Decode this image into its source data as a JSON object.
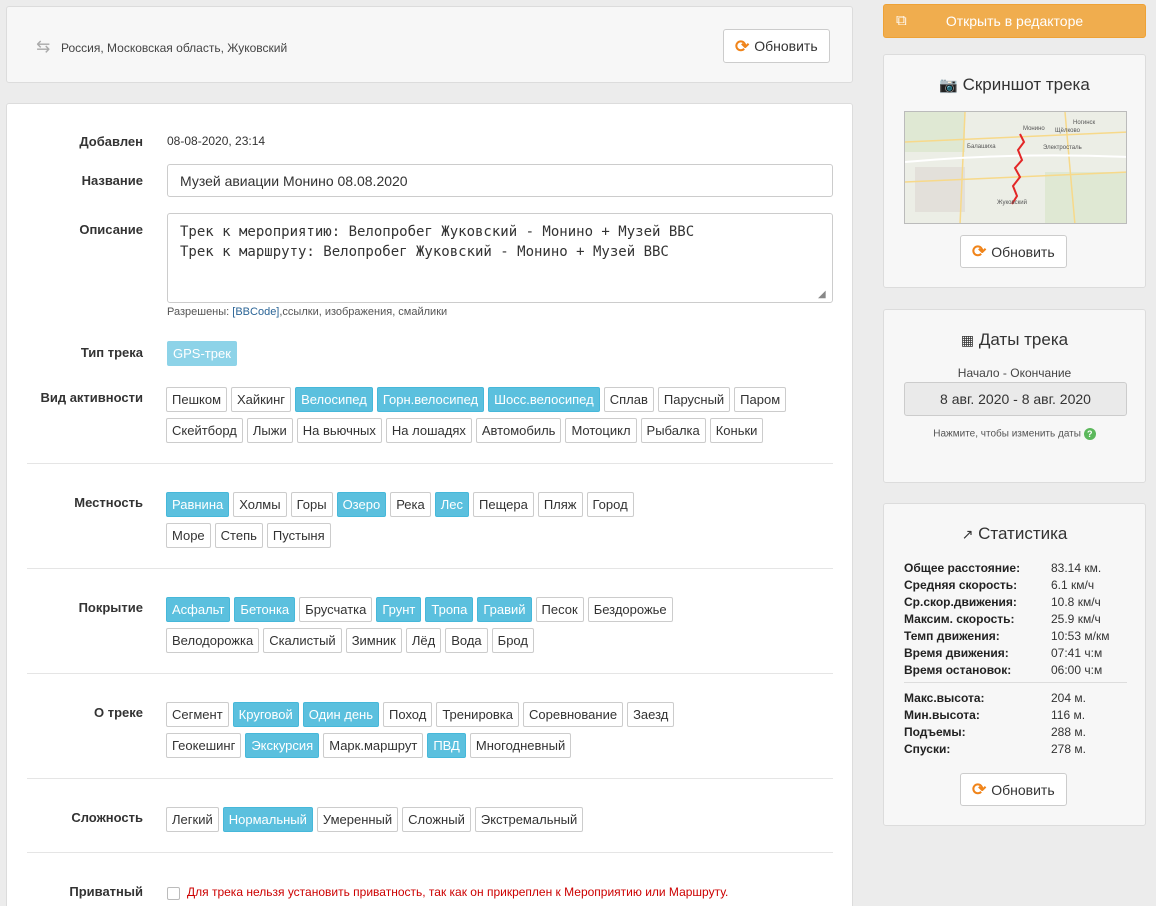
{
  "location": {
    "text": "Россия, Московская область, Жуковский",
    "refresh_label": "Обновить"
  },
  "form": {
    "added_label": "Добавлен",
    "added_value": "08-08-2020, 23:14",
    "name_label": "Название",
    "name_value": "Музей авиации Монино 08.08.2020",
    "desc_label": "Описание",
    "desc_value": "Трек к мероприятию: Велопробег Жуковский - Монино + Музей ВВС\nТрек к маршруту: Велопробег Жуковский - Монино + Музей ВВС",
    "allowed_prefix": "Разрешены: ",
    "allowed_link": "[BBCode]",
    "allowed_suffix": ",ссылки, изображения, смайлики",
    "type_label": "Тип трека",
    "type_value": "GPS-трек",
    "activity_label": "Вид активности",
    "terrain_label": "Местность",
    "surface_label": "Покрытие",
    "about_label": "О треке",
    "difficulty_label": "Сложность",
    "private_label": "Приватный",
    "private_note": "Для трека нельзя установить приватность, так как он прикреплен к Мероприятию или Маршруту."
  },
  "activity": [
    [
      {
        "t": "Пешком",
        "on": false
      },
      {
        "t": "Хайкинг",
        "on": false
      },
      {
        "t": "Велосипед",
        "on": true
      },
      {
        "t": "Горн.велосипед",
        "on": true
      },
      {
        "t": "Шосс.велосипед",
        "on": true
      },
      {
        "t": "Сплав",
        "on": false
      },
      {
        "t": "Парусный",
        "on": false
      },
      {
        "t": "Паром",
        "on": false
      }
    ],
    [
      {
        "t": "Скейтборд",
        "on": false
      },
      {
        "t": "Лыжи",
        "on": false
      },
      {
        "t": "На вьючных",
        "on": false
      },
      {
        "t": "На лошадях",
        "on": false
      },
      {
        "t": "Автомобиль",
        "on": false
      },
      {
        "t": "Мотоцикл",
        "on": false
      },
      {
        "t": "Рыбалка",
        "on": false
      },
      {
        "t": "Коньки",
        "on": false
      }
    ]
  ],
  "terrain": [
    [
      {
        "t": "Равнина",
        "on": true
      },
      {
        "t": "Холмы",
        "on": false
      },
      {
        "t": "Горы",
        "on": false
      },
      {
        "t": "Озеро",
        "on": true
      },
      {
        "t": "Река",
        "on": false
      },
      {
        "t": "Лес",
        "on": true
      },
      {
        "t": "Пещера",
        "on": false
      },
      {
        "t": "Пляж",
        "on": false
      },
      {
        "t": "Город",
        "on": false
      }
    ],
    [
      {
        "t": "Море",
        "on": false
      },
      {
        "t": "Степь",
        "on": false
      },
      {
        "t": "Пустыня",
        "on": false
      }
    ]
  ],
  "surface": [
    [
      {
        "t": "Асфальт",
        "on": true
      },
      {
        "t": "Бетонка",
        "on": true
      },
      {
        "t": "Брусчатка",
        "on": false
      },
      {
        "t": "Грунт",
        "on": true
      },
      {
        "t": "Тропа",
        "on": true
      },
      {
        "t": "Гравий",
        "on": true
      },
      {
        "t": "Песок",
        "on": false
      },
      {
        "t": "Бездорожье",
        "on": false
      }
    ],
    [
      {
        "t": "Велодорожка",
        "on": false
      },
      {
        "t": "Скалистый",
        "on": false
      },
      {
        "t": "Зимник",
        "on": false
      },
      {
        "t": "Лёд",
        "on": false
      },
      {
        "t": "Вода",
        "on": false
      },
      {
        "t": "Брод",
        "on": false
      }
    ]
  ],
  "about": [
    [
      {
        "t": "Сегмент",
        "on": false
      },
      {
        "t": "Круговой",
        "on": true
      },
      {
        "t": "Один день",
        "on": true
      },
      {
        "t": "Поход",
        "on": false
      },
      {
        "t": "Тренировка",
        "on": false
      },
      {
        "t": "Соревнование",
        "on": false
      },
      {
        "t": "Заезд",
        "on": false
      }
    ],
    [
      {
        "t": "Геокешинг",
        "on": false
      },
      {
        "t": "Экскурсия",
        "on": true
      },
      {
        "t": "Марк.маршрут",
        "on": false
      },
      {
        "t": "ПВД",
        "on": true
      },
      {
        "t": "Многодневный",
        "on": false
      }
    ]
  ],
  "difficulty": [
    [
      {
        "t": "Легкий",
        "on": false
      },
      {
        "t": "Нормальный",
        "on": true
      },
      {
        "t": "Умеренный",
        "on": false
      },
      {
        "t": "Сложный",
        "on": false
      },
      {
        "t": "Экстремальный",
        "on": false
      }
    ]
  ],
  "sidebar": {
    "editor_label": "Открыть в редакторе",
    "screenshot_title": "Скриншот трека",
    "refresh_label": "Обновить",
    "dates_title": "Даты трека",
    "dates_caption": "Начало - Окончание",
    "dates_value": "8 авг. 2020 - 8 авг. 2020",
    "dates_hint": "Нажмите, чтобы изменить даты",
    "stats_title": "Статистика"
  },
  "stats": [
    {
      "k": "Общее расстояние:",
      "v": "83.14 км."
    },
    {
      "k": "Средняя скорость:",
      "v": "6.1 км/ч"
    },
    {
      "k": "Ср.скор.движения:",
      "v": "10.8 км/ч"
    },
    {
      "k": "Максим. скорость:",
      "v": "25.9 км/ч"
    },
    {
      "k": "Темп движения:",
      "v": "10:53 м/км"
    },
    {
      "k": "Время движения:",
      "v": "07:41 ч:м"
    },
    {
      "k": "Время остановок:",
      "v": "06:00 ч:м"
    }
  ],
  "stats2": [
    {
      "k": "Макс.высота:",
      "v": "204 м."
    },
    {
      "k": "Мин.высота:",
      "v": "116 м."
    },
    {
      "k": "Подъемы:",
      "v": "288 м."
    },
    {
      "k": "Спуски:",
      "v": "278 м."
    }
  ],
  "map_labels": [
    "Балашиха",
    "Щёлково",
    "Электросталь",
    "Жуковский",
    "Ногинск",
    "Монино"
  ],
  "colors": {
    "accent": "#5bc0de",
    "editor_button": "#f0ad4e",
    "refresh_icon": "#f0841a",
    "warning_text": "#cc0000"
  }
}
